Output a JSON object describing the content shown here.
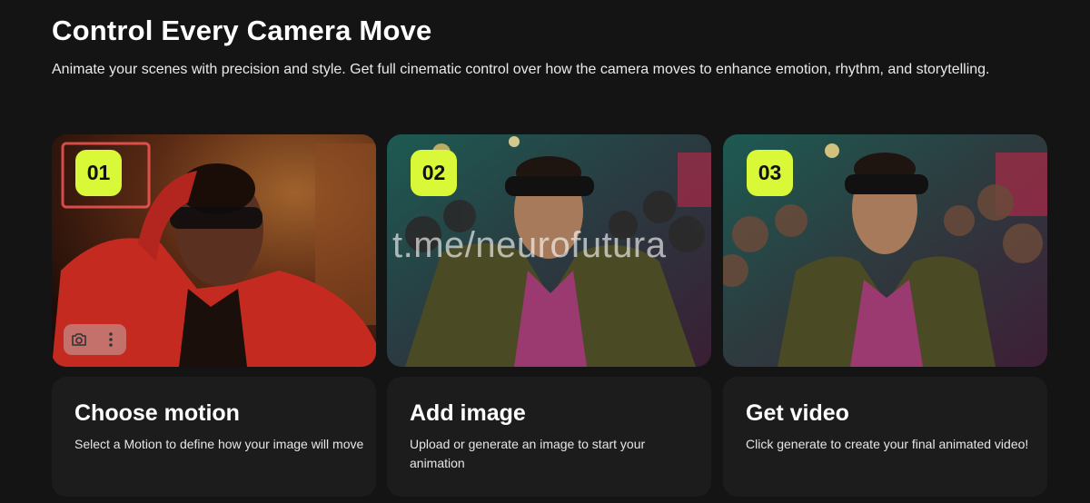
{
  "header": {
    "title": "Control Every Camera Move",
    "subtitle": "Animate your scenes with precision and style. Get full cinematic control over how the camera moves to enhance emotion, rhythm, and storytelling."
  },
  "steps": [
    {
      "number": "01",
      "title": "Choose motion",
      "description": "Select a Motion to define how your image will move"
    },
    {
      "number": "02",
      "title": "Add image",
      "description": "Upload or generate an image to start your animation"
    },
    {
      "number": "03",
      "title": "Get video",
      "description": "Click generate to create your final animated video!"
    }
  ],
  "watermark": "t.me/neurofutura",
  "icons": {
    "camera": "camera-icon",
    "more": "more-vertical-icon"
  },
  "colors": {
    "background": "#141414",
    "card": "#1c1c1c",
    "badge": "#d8f838"
  }
}
